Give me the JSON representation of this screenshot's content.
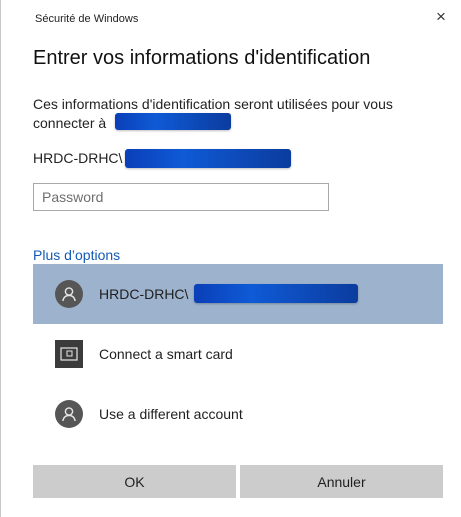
{
  "window": {
    "title": "Sécurité de Windows",
    "close_label": "×"
  },
  "header": {
    "title": "Entrer vos informations d'identification"
  },
  "info": {
    "text": "Ces informations d'identification seront utilisées pour vous connecter à"
  },
  "account": {
    "username_prefix": "HRDC-DRHC\\"
  },
  "password": {
    "placeholder": "Password",
    "value": ""
  },
  "more_options": {
    "label": "Plus d’options"
  },
  "options": [
    {
      "label": "HRDC-DRHC\\",
      "icon": "user-icon",
      "selected": true
    },
    {
      "label": "Connect a smart card",
      "icon": "smart-card-icon",
      "selected": false
    },
    {
      "label": "Use a different account",
      "icon": "user-icon",
      "selected": false
    }
  ],
  "buttons": {
    "ok_label": "OK",
    "cancel_label": "Annuler"
  },
  "colors": {
    "link": "#1459b6",
    "selected_bg": "#9db3cd",
    "button_bg": "#cccccc",
    "redaction": "#0f5ad6"
  }
}
